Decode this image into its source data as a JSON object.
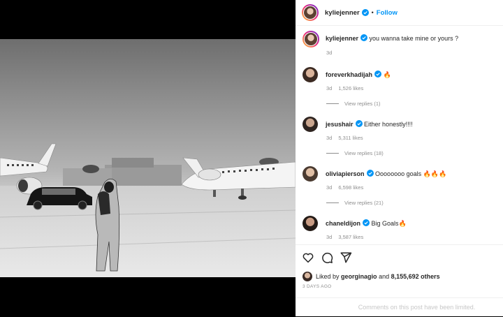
{
  "post": {
    "username": "kyliejenner",
    "follow_label": "Follow",
    "separator": "•"
  },
  "caption": {
    "username": "kyliejenner",
    "text": "you wanna take mine or yours ?",
    "time": "3d"
  },
  "comments": [
    {
      "username": "foreverkhadijah",
      "text": "🔥",
      "time": "3d",
      "likes": "1,526 likes",
      "replies": "View replies (1)"
    },
    {
      "username": "jesushair",
      "text": "Either honestly!!!!",
      "time": "3d",
      "likes": "5,311 likes",
      "replies": "View replies (18)"
    },
    {
      "username": "oliviapierson",
      "text": "Oooooooo goals 🔥🔥🔥",
      "time": "3d",
      "likes": "6,598 likes",
      "replies": "View replies (21)"
    },
    {
      "username": "chaneldijon",
      "text": "Big Goals🔥",
      "time": "3d",
      "likes": "3,587 likes",
      "replies": ""
    }
  ],
  "likes": {
    "prefix": "Liked by",
    "first_liker": "georginagio",
    "conjunction": "and",
    "others": "8,155,692 others"
  },
  "timestamp": "3 DAYS AGO",
  "comments_limited": "Comments on this post have been limited.",
  "colors": {
    "accent": "#0095f6",
    "verified": "#0095f6",
    "meta": "#8e8e8e"
  },
  "icons": [
    "heart-icon",
    "comment-icon",
    "share-icon",
    "verified-icon"
  ]
}
